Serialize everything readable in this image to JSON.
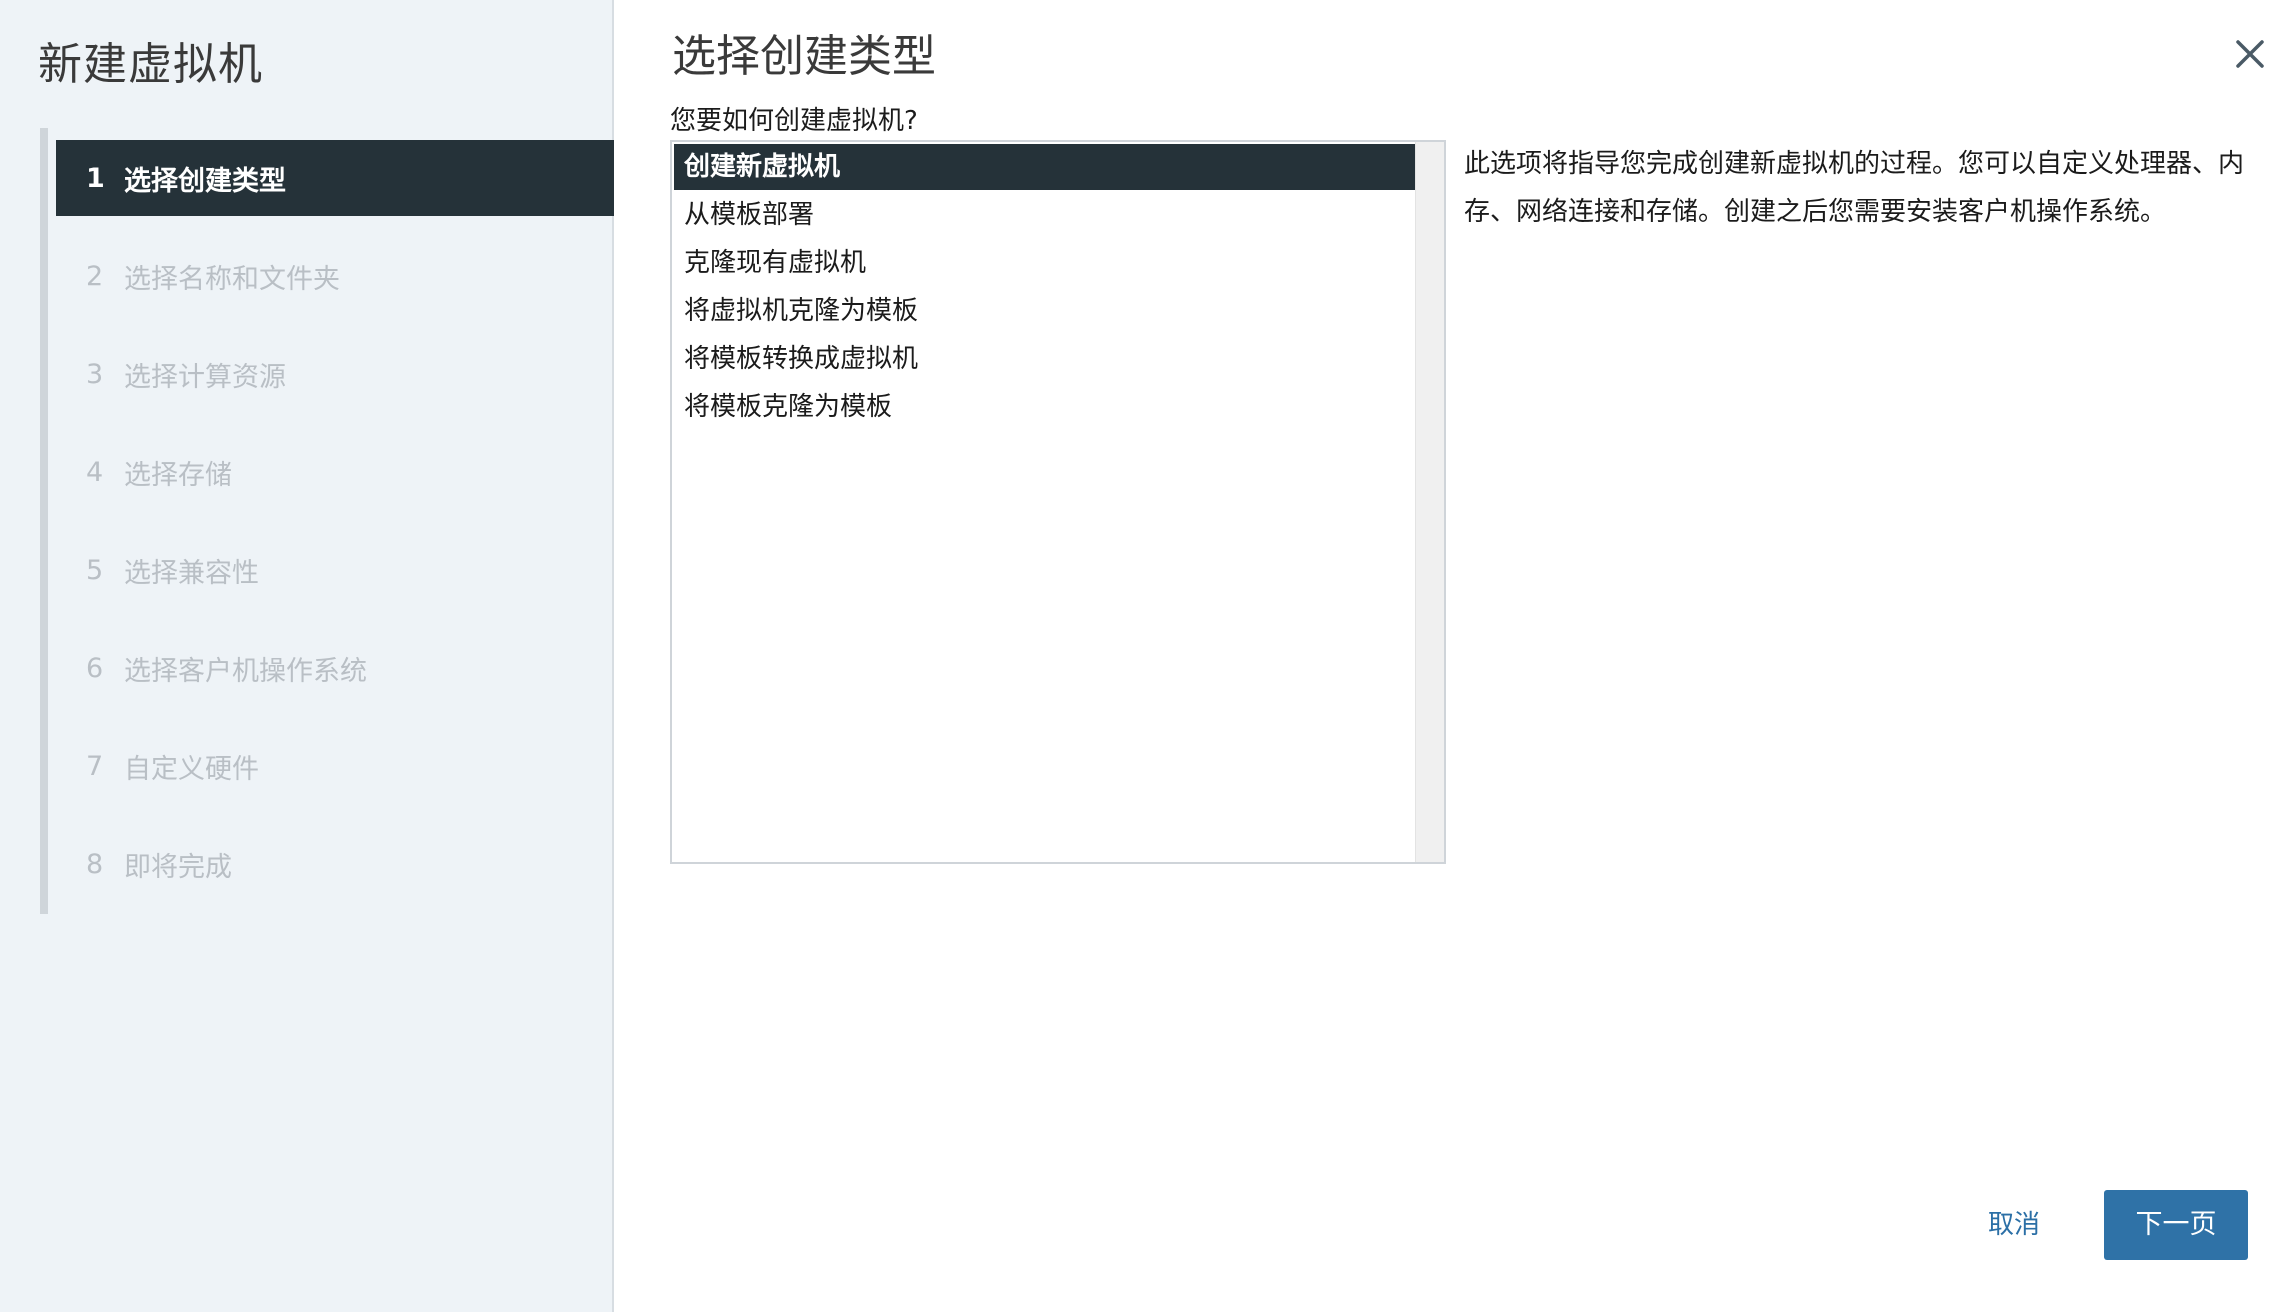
{
  "wizard": {
    "title": "新建虚拟机",
    "steps": [
      {
        "num": "1",
        "label": "选择创建类型"
      },
      {
        "num": "2",
        "label": "选择名称和文件夹"
      },
      {
        "num": "3",
        "label": "选择计算资源"
      },
      {
        "num": "4",
        "label": "选择存储"
      },
      {
        "num": "5",
        "label": "选择兼容性"
      },
      {
        "num": "6",
        "label": "选择客户机操作系统"
      },
      {
        "num": "7",
        "label": "自定义硬件"
      },
      {
        "num": "8",
        "label": "即将完成"
      }
    ],
    "active_step": 1
  },
  "main": {
    "title": "选择创建类型",
    "prompt": "您要如何创建虚拟机?",
    "types": [
      "创建新虚拟机",
      "从模板部署",
      "克隆现有虚拟机",
      "将虚拟机克隆为模板",
      "将模板转换成虚拟机",
      "将模板克隆为模板"
    ],
    "selected_type": "创建新虚拟机",
    "description": "此选项将指导您完成创建新虚拟机的过程。您可以自定义处理器、内存、网络连接和存储。创建之后您需要安装客户机操作系统。"
  },
  "footer": {
    "cancel_label": "取消",
    "next_label": "下一页"
  },
  "icons": {
    "close": "close-icon",
    "annotation_arrow": "red-arrow-icon"
  },
  "colors": {
    "active_bg": "#253239",
    "primary_button": "#2f72a7",
    "link": "#2b6fa6",
    "annotation": "#e8412c"
  }
}
